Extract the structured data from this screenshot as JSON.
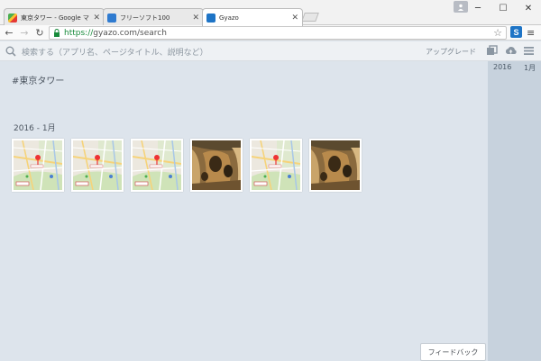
{
  "browser": {
    "tabs": [
      {
        "title": "東京タワー - Google マップ",
        "favicon": "google-maps-icon"
      },
      {
        "title": "フリーソフト100",
        "favicon": "freesoft-icon"
      },
      {
        "title": "Gyazo",
        "favicon": "gyazo-icon",
        "active": true
      }
    ],
    "url_scheme": "https://",
    "url_rest": "gyazo.com/search"
  },
  "gyazo": {
    "search_placeholder": "検索する（アプリ名、ページタイトル、説明など）",
    "upgrade_label": "アップグレード",
    "tag_title": "#東京タワー",
    "month_label": "2016 - 1月",
    "thumbnails": [
      {
        "kind": "map"
      },
      {
        "kind": "map"
      },
      {
        "kind": "map"
      },
      {
        "kind": "cliff"
      },
      {
        "kind": "map"
      },
      {
        "kind": "cliff"
      }
    ],
    "sidebar_year": "2016",
    "sidebar_month": "1月",
    "feedback_label": "フィードバック"
  },
  "colors": {
    "accent": "#1e74c6",
    "background": "#dde4ec",
    "sidebar": "#c7d2dd"
  }
}
